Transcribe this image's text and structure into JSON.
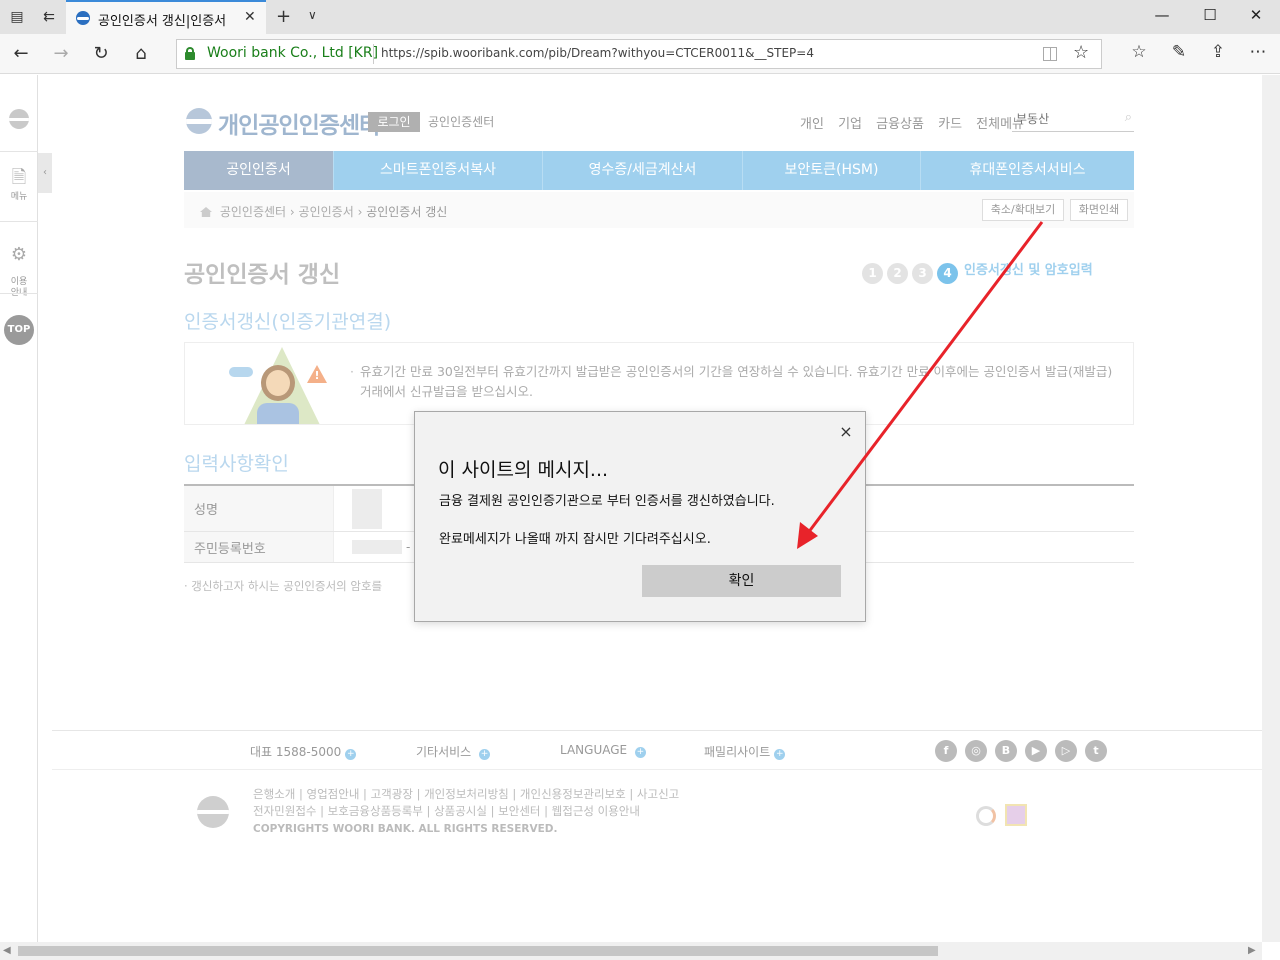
{
  "browser": {
    "tab_title": "공인인증서 갱신|인증서",
    "site_identity": "Woori bank Co., Ltd [KR]",
    "url": "https://spib.wooribank.com/pib/Dream?withyou=CTCER0011&__STEP=4"
  },
  "leftbar": {
    "menu_label": "메뉴",
    "guide_label": "이용\n안내",
    "top_label": "TOP"
  },
  "header": {
    "logo_text": "개인공인인증센터",
    "login_label": "로그인",
    "center_label": "공인인증센터",
    "top_menu": [
      "개인",
      "기업",
      "금융상품",
      "카드",
      "전체메뉴"
    ],
    "search_placeholder": "부동산"
  },
  "gnb": [
    "공인인증서",
    "스마트폰인증서복사",
    "영수증/세금계산서",
    "보안토큰(HSM)",
    "휴대폰인증서서비스"
  ],
  "breadcrumb": {
    "items": [
      "공인인증센터",
      "공인인증서",
      "공인인증서 갱신"
    ],
    "zoom_label": "축소/확대보기",
    "print_label": "화면인쇄"
  },
  "page": {
    "title": "공인인증서 갱신",
    "steps": [
      "1",
      "2",
      "3",
      "4"
    ],
    "step_label": "인증서갱신 및 암호입력",
    "section1_title": "인증서갱신(인증기관연결)",
    "info_text": "유효기간 만료 30일전부터 유효기간까지 발급받은 공인인증서의 기간을 연장하실 수 있습니다. 유효기간 만료 이후에는 공인인증서 발급(재발급)거래에서 신규발급을 받으십시오.",
    "section2_title": "입력사항확인",
    "row_name_label": "성명",
    "row_id_label": "주민등록번호",
    "id_dash": "-",
    "note": "· 갱신하고자 하시는 공인인증서의 암호를"
  },
  "footer": {
    "phone": "대표 1588-5000",
    "others": "기타서비스",
    "language": "LANGUAGE",
    "family": "패밀리사이트",
    "links_line1": "은행소개 | 영업점안내 | 고객광장 | 개인정보처리방침 | 개인신용정보관리보호 | 사고신고",
    "links_line2": "전자민원접수 | 보호금융상품등록부 | 상품공시실 | 보안센터 | 웹접근성 이용안내",
    "copyright": "COPYRIGHTS WOORI BANK. ALL RIGHTS RESERVED.",
    "sns": [
      "f",
      "◎",
      "B",
      "▶",
      "▷",
      "t"
    ]
  },
  "dialog": {
    "title": "이 사이트의 메시지...",
    "message1": "금융 결제원 공인인증기관으로 부터 인증서를 갱신하였습니다.",
    "message2": "완료메세지가 나올때 까지 잠시만 기다려주십시오.",
    "ok_label": "확인",
    "close_glyph": "×"
  },
  "annotation": {
    "arrow_color": "#e8232a"
  }
}
